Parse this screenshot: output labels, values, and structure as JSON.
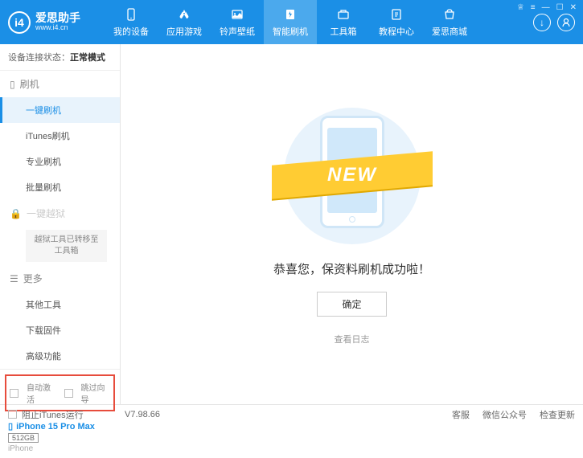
{
  "app": {
    "title": "爱思助手",
    "url": "www.i4.cn"
  },
  "winControls": {
    "gift": "♕",
    "menu": "≡",
    "min": "—",
    "max": "☐",
    "close": "✕"
  },
  "nav": [
    {
      "label": "我的设备",
      "icon": "device"
    },
    {
      "label": "应用游戏",
      "icon": "apps"
    },
    {
      "label": "铃声壁纸",
      "icon": "media"
    },
    {
      "label": "智能刷机",
      "icon": "flash",
      "active": true
    },
    {
      "label": "工具箱",
      "icon": "tools"
    },
    {
      "label": "教程中心",
      "icon": "help"
    },
    {
      "label": "爱思商城",
      "icon": "shop"
    }
  ],
  "headerBtns": {
    "download": "↓",
    "user": "👤"
  },
  "status": {
    "label": "设备连接状态：",
    "value": "正常模式"
  },
  "sidebar": {
    "flash_group": "刷机",
    "items1": [
      "一键刷机",
      "iTunes刷机",
      "专业刷机",
      "批量刷机"
    ],
    "jailbreak_group": "一键越狱",
    "jailbreak_note": "越狱工具已转移至工具箱",
    "more_group": "更多",
    "items2": [
      "其他工具",
      "下载固件",
      "高级功能"
    ]
  },
  "checks": {
    "autoActivate": "自动激活",
    "skipGuide": "跳过向导"
  },
  "device": {
    "name": "iPhone 15 Pro Max",
    "storage": "512GB",
    "type": "iPhone"
  },
  "main": {
    "ribbon": "NEW",
    "success": "恭喜您，保资料刷机成功啦！",
    "ok": "确定",
    "viewLog": "查看日志"
  },
  "footer": {
    "blockItunes": "阻止iTunes运行",
    "version": "V7.98.66",
    "links": [
      "客服",
      "微信公众号",
      "检查更新"
    ]
  }
}
